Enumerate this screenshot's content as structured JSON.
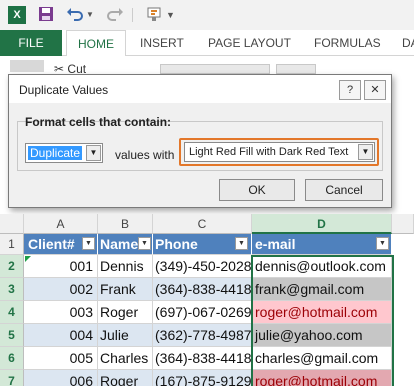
{
  "app": {
    "logo_letter": "X",
    "accent_color": "#217346"
  },
  "quick_access": {
    "icons": [
      "excel-logo-icon",
      "save-icon",
      "undo-icon",
      "dropdown-icon",
      "redo-icon",
      "format-painter-icon",
      "customize-icon"
    ]
  },
  "ribbon": {
    "tabs": [
      "FILE",
      "HOME",
      "INSERT",
      "PAGE LAYOUT",
      "FORMULAS",
      "DA"
    ],
    "active_tab": "HOME",
    "clipboard": {
      "cut_label": "Cut"
    }
  },
  "dialog": {
    "title": "Duplicate Values",
    "help_glyph": "?",
    "close_glyph": "✕",
    "group_label": "Format cells that contain:",
    "type_value": "Duplicate",
    "values_with_label": "values with",
    "format_value": "Light Red Fill with Dark Red Text",
    "ok_label": "OK",
    "cancel_label": "Cancel",
    "highlight_color": "#e3772a"
  },
  "sheet": {
    "columns": [
      "A",
      "B",
      "C",
      "D"
    ],
    "active_column": "D",
    "rows": [
      "1",
      "2",
      "3",
      "4",
      "5",
      "6",
      "7"
    ],
    "headers": [
      "Client#",
      "Name",
      "Phone",
      "e-mail"
    ],
    "data": [
      {
        "client": "001",
        "name": "Dennis",
        "phone": "(349)-450-2028",
        "email": "dennis@outlook.com",
        "duplicate": false
      },
      {
        "client": "002",
        "name": "Frank",
        "phone": "(364)-838-4418",
        "email": "frank@gmail.com",
        "duplicate": false
      },
      {
        "client": "003",
        "name": "Roger",
        "phone": "(697)-067-0269",
        "email": "roger@hotmail.com",
        "duplicate": true
      },
      {
        "client": "004",
        "name": "Julie",
        "phone": "(362)-778-4987",
        "email": "julie@yahoo.com",
        "duplicate": false
      },
      {
        "client": "005",
        "name": "Charles",
        "phone": "(364)-838-4418",
        "email": "charles@gmail.com",
        "duplicate": false
      },
      {
        "client": "006",
        "name": "Roger",
        "phone": "(167)-875-9129",
        "email": "roger@hotmail.com",
        "duplicate": true
      }
    ],
    "header_color": "#4f81bd",
    "duplicate_fill": "#ffc7ce",
    "duplicate_text": "#9c0006"
  }
}
